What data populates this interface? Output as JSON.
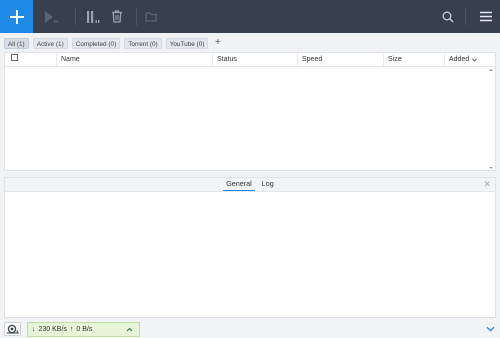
{
  "toolbar": {
    "buttons": [
      "add-icon",
      "play-icon",
      "pause-icon",
      "trash-icon",
      "folder-icon",
      "search-icon",
      "menu-icon"
    ]
  },
  "filters": [
    {
      "label": "All (1)",
      "active": true
    },
    {
      "label": "Active (1)",
      "active": false
    },
    {
      "label": "Completed (0)",
      "active": false
    },
    {
      "label": "Torrent (0)",
      "active": false
    },
    {
      "label": "YouTube (0)",
      "active": false
    }
  ],
  "filters_add": "+",
  "table": {
    "columns": {
      "name": "Name",
      "status": "Status",
      "speed": "Speed",
      "size": "Size",
      "added": "Added"
    },
    "rows": []
  },
  "pane": {
    "tabs": {
      "general": "General",
      "log": "Log"
    },
    "active_tab": "General"
  },
  "status": {
    "down_speed": "230 KB/s",
    "up_speed": "0 B/s"
  },
  "colors": {
    "toolbar_bg": "#37404d",
    "accent": "#1e88e5",
    "speed_bg": "#e6f4d8"
  }
}
